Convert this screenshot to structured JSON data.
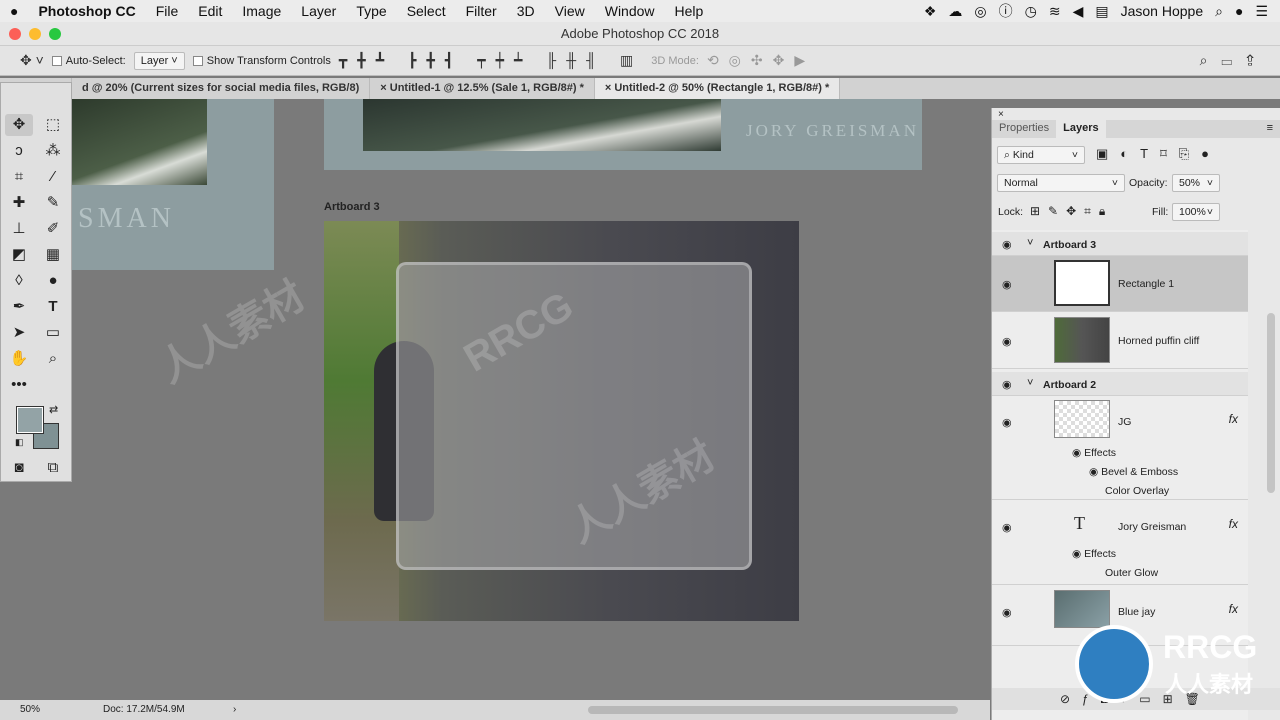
{
  "menubar": {
    "apple": "",
    "app": "Photoshop CC",
    "items": [
      "File",
      "Edit",
      "Image",
      "Layer",
      "Type",
      "Select",
      "Filter",
      "3D",
      "View",
      "Window",
      "Help"
    ],
    "user": "Jason Hoppe"
  },
  "window": {
    "title": "Adobe Photoshop CC 2018"
  },
  "options": {
    "auto_select": "Auto-Select:",
    "auto_select_value": "Layer",
    "show_transform": "Show Transform Controls",
    "mode_3d": "3D Mode:"
  },
  "tabs": [
    {
      "label": "d @ 20% (Current sizes for  social media files, RGB/8)",
      "active": false
    },
    {
      "label": "Untitled-1 @ 12.5% (Sale 1, RGB/8#) *",
      "active": false
    },
    {
      "label": "Untitled-2 @ 50% (Rectangle 1, RGB/8#) *",
      "active": true
    }
  ],
  "canvas": {
    "artboard_label": "Artboard 3",
    "top_text": "JORY GREISMAN",
    "left_text": "SMAN"
  },
  "colors": {
    "foreground": "#93a3a6",
    "background": "#7f9194",
    "canvas_bg": "#7a7a7a"
  },
  "layers_panel": {
    "tabs": [
      "Properties",
      "Layers"
    ],
    "active_tab": "Layers",
    "filter": "Kind",
    "blend_mode": "Normal",
    "opacity_label": "Opacity:",
    "opacity": "50%",
    "lock_label": "Lock:",
    "fill_label": "Fill:",
    "fill": "100%",
    "rows": [
      {
        "type": "group",
        "name": "Artboard 3"
      },
      {
        "type": "layer",
        "name": "Rectangle 1",
        "selected": true
      },
      {
        "type": "layer",
        "name": "Horned puffin cliff"
      },
      {
        "type": "group",
        "name": "Artboard 2"
      },
      {
        "type": "layer",
        "name": "JG",
        "fx": "fx"
      },
      {
        "type": "effect",
        "name": "Effects"
      },
      {
        "type": "effect",
        "name": "Bevel & Emboss"
      },
      {
        "type": "effect",
        "name": "Color Overlay"
      },
      {
        "type": "layer",
        "name": "Jory Greisman",
        "fx": "fx"
      },
      {
        "type": "effect",
        "name": "Effects"
      },
      {
        "type": "effect",
        "name": "Outer Glow"
      },
      {
        "type": "layer",
        "name": "Blue jay",
        "fx": "fx"
      }
    ]
  },
  "status": {
    "zoom": "50%",
    "doc": "Doc: 17.2M/54.9M"
  },
  "watermark": {
    "logo": "RRCG",
    "sub": "人人素材"
  }
}
